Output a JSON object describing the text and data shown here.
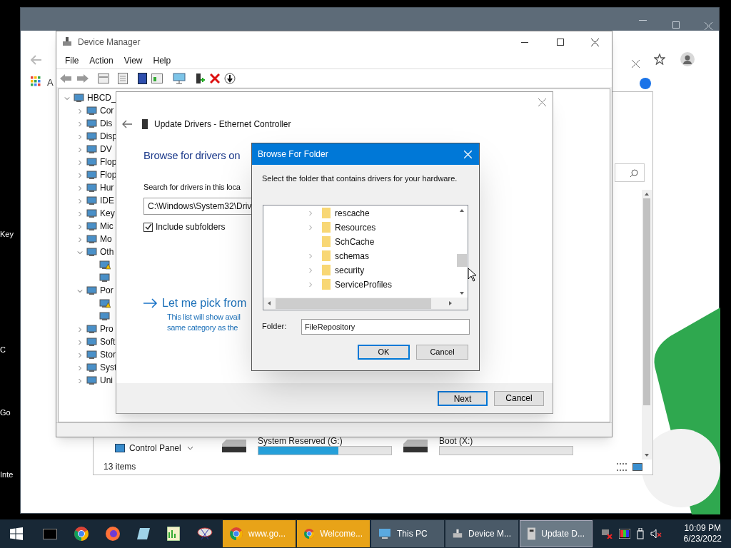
{
  "desktop_labels": [
    "Key",
    "C",
    "Go",
    "Inte"
  ],
  "browser": {
    "bookmark": "A"
  },
  "explorer": {
    "nav_item": "Control Panel",
    "drives": [
      {
        "label": "System Reserved (G:)",
        "level": 0.6
      },
      {
        "label": "Boot (X:)",
        "level": 0
      }
    ],
    "status": "13 items"
  },
  "device_manager": {
    "title": "Device Manager",
    "menu": [
      "File",
      "Action",
      "View",
      "Help"
    ],
    "tree": [
      {
        "label": "HBCD_",
        "expanded": true,
        "children": [
          {
            "label": "Cor",
            "expanded": false
          },
          {
            "label": "Dis",
            "expanded": false
          },
          {
            "label": "Disp",
            "expanded": false
          },
          {
            "label": "DV",
            "expanded": false
          },
          {
            "label": "Flop",
            "expanded": false
          },
          {
            "label": "Flop",
            "expanded": false
          },
          {
            "label": "Hur",
            "expanded": false
          },
          {
            "label": "IDE",
            "expanded": false
          },
          {
            "label": "Key",
            "expanded": false
          },
          {
            "label": "Mic",
            "expanded": false
          },
          {
            "label": "Mo",
            "expanded": false
          },
          {
            "label": "Oth",
            "expanded": true,
            "children": [
              {
                "warning": true
              },
              {
                "warning": false
              }
            ]
          },
          {
            "label": "Por",
            "expanded": true,
            "children": [
              {
                "warning": true
              },
              {
                "warning": false
              }
            ]
          },
          {
            "label": "Pro",
            "expanded": false
          },
          {
            "label": "Soft",
            "expanded": false
          },
          {
            "label": "Stor",
            "expanded": false
          },
          {
            "label": "Syst",
            "expanded": false
          },
          {
            "label": "Uni",
            "expanded": false
          }
        ]
      }
    ]
  },
  "update_drivers": {
    "title": "Update Drivers - Ethernet Controller",
    "heading": "Browse for drivers on",
    "search_label": "Search for drivers in this loca",
    "path": "C:\\Windows\\System32\\Driv",
    "include_subfolders": {
      "label": "Include subfolders",
      "checked": true
    },
    "pick_title": "Let me pick from",
    "pick_desc": [
      "This list will show avail",
      "same category as the"
    ],
    "buttons": [
      "Next",
      "Cancel"
    ]
  },
  "browse_dialog": {
    "title": "Browse For Folder",
    "prompt": "Select the folder that contains drivers for your hardware.",
    "folders": [
      {
        "name": "rescache",
        "expandable": true
      },
      {
        "name": "Resources",
        "expandable": true
      },
      {
        "name": "SchCache",
        "expandable": false
      },
      {
        "name": "schemas",
        "expandable": true
      },
      {
        "name": "security",
        "expandable": true
      },
      {
        "name": "ServiceProfiles",
        "expandable": true
      }
    ],
    "folder_label": "Folder:",
    "folder_value": "FileRepository",
    "buttons": [
      "OK",
      "Cancel"
    ]
  },
  "taskbar": {
    "buttons": [
      {
        "label": "www.go...",
        "kind": "browser",
        "flashing": true,
        "selected": false
      },
      {
        "label": "Welcome...",
        "kind": "browser",
        "flashing": true,
        "selected": false
      },
      {
        "label": "This PC",
        "kind": "computer",
        "flashing": false,
        "selected": false
      },
      {
        "label": "Device M...",
        "kind": "devices",
        "flashing": false,
        "selected": false
      },
      {
        "label": "Update D...",
        "kind": "device",
        "flashing": false,
        "selected": true
      }
    ],
    "time": "10:09 PM",
    "date": "6/23/2022"
  }
}
